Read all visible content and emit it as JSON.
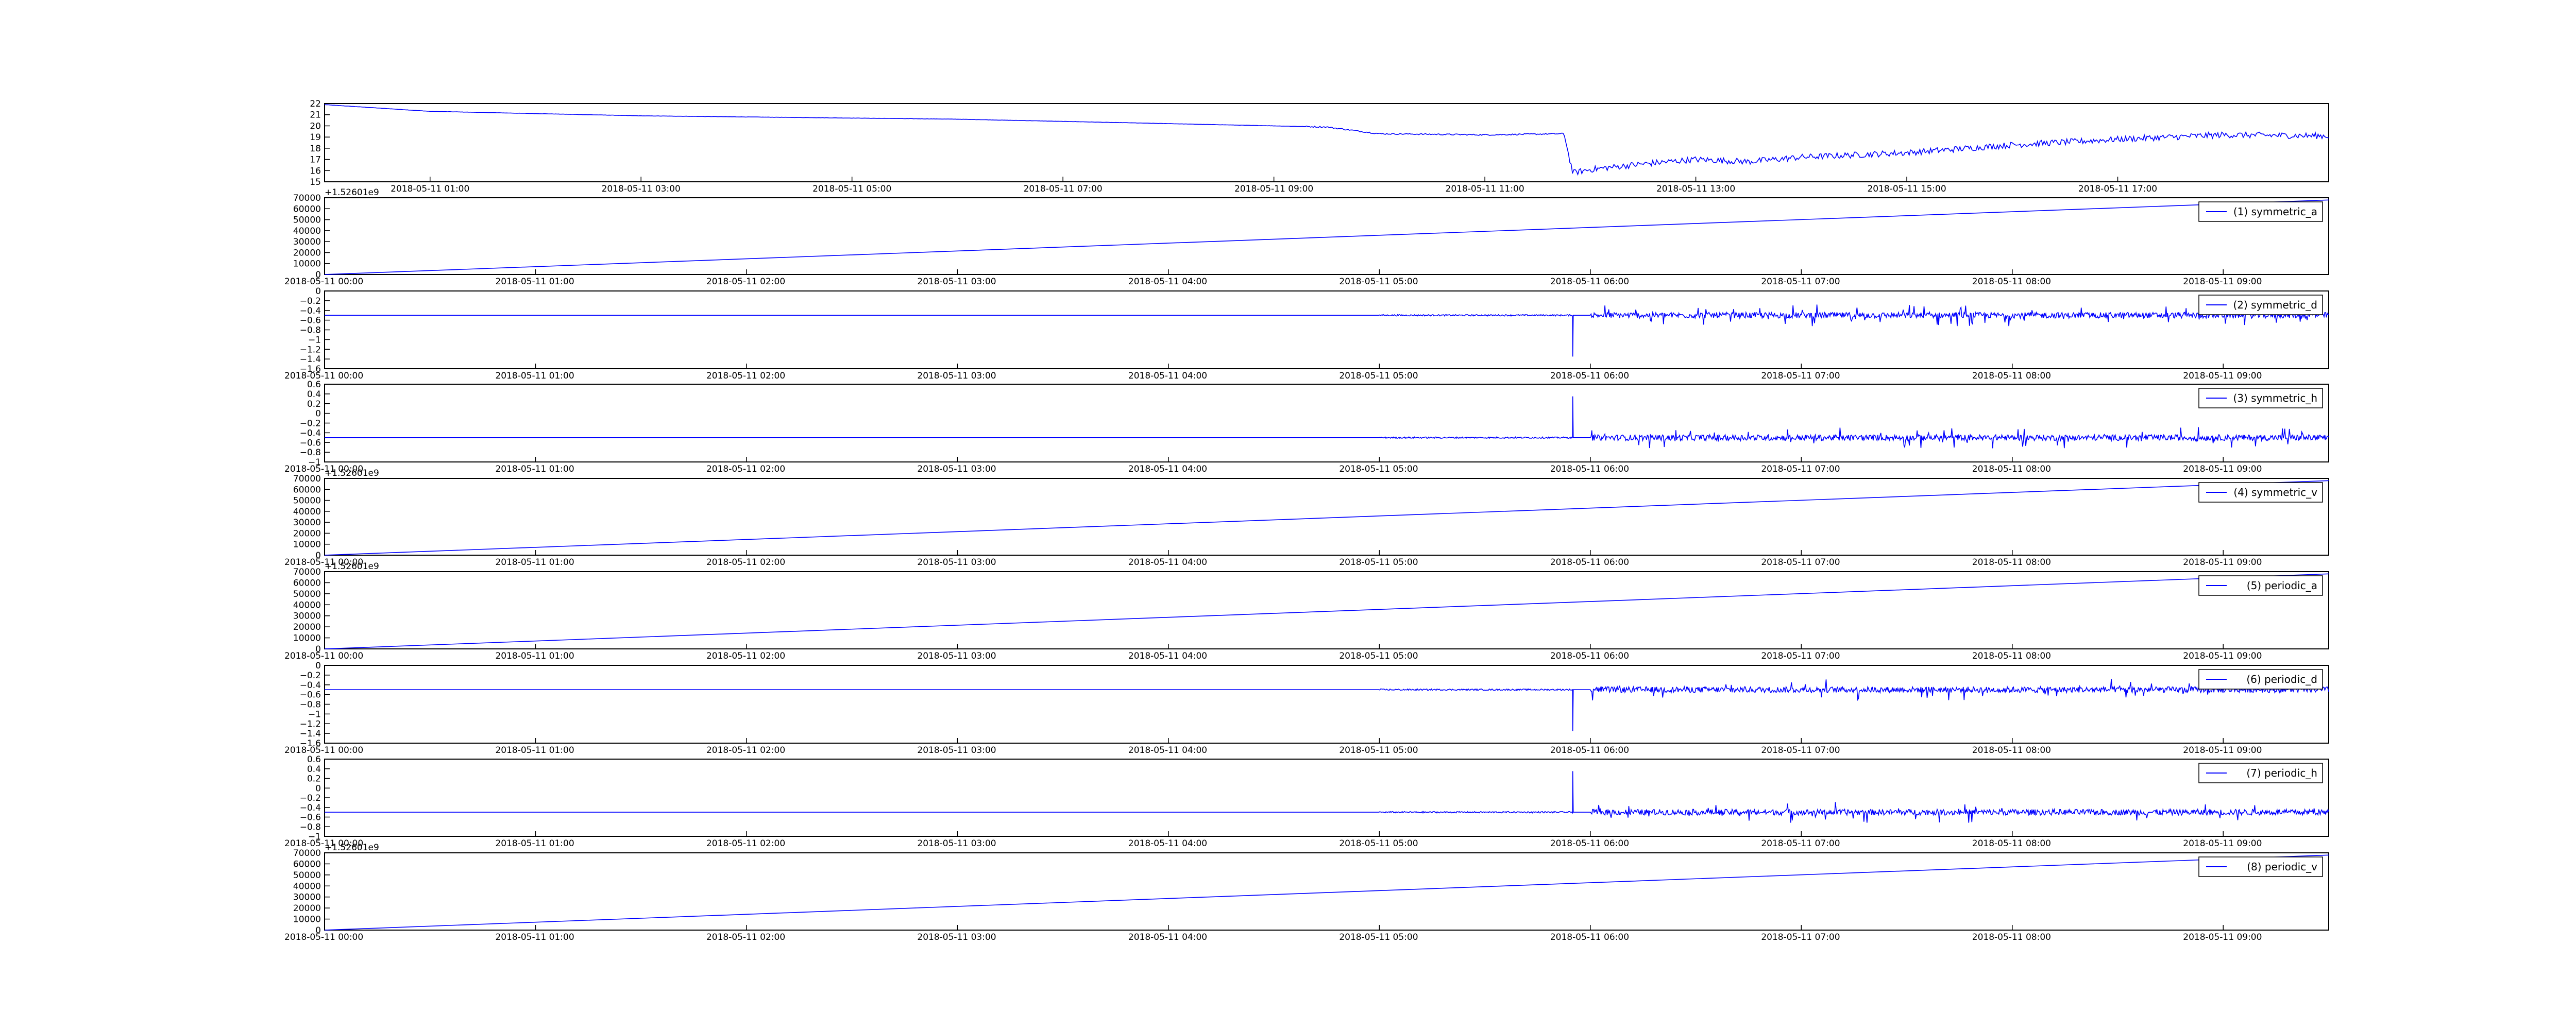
{
  "figure": {
    "line_color": "#0000ff",
    "frame_color": "#000000",
    "background": "#ffffff"
  },
  "chart_data": [
    {
      "type": "line",
      "legend": null,
      "x_label_anchor": "middle",
      "x_ticks": [
        "2018-05-11 01:00",
        "2018-05-11 03:00",
        "2018-05-11 05:00",
        "2018-05-11 07:00",
        "2018-05-11 09:00",
        "2018-05-11 11:00",
        "2018-05-11 13:00",
        "2018-05-11 15:00",
        "2018-05-11 17:00"
      ],
      "y_ticks": [
        15,
        16,
        17,
        18,
        19,
        20,
        21,
        22
      ],
      "ylim": [
        15,
        22
      ],
      "offset_label": "",
      "signal": "temperature",
      "series": [
        {
          "x": [
            "2018-05-11 00:00",
            "2018-05-11 01:00",
            "2018-05-11 02:00",
            "2018-05-11 03:00",
            "2018-05-11 04:00",
            "2018-05-11 05:00",
            "2018-05-11 06:00",
            "2018-05-11 07:00",
            "2018-05-11 08:00",
            "2018-05-11 09:00",
            "2018-05-11 09:30",
            "2018-05-11 10:00",
            "2018-05-11 11:00",
            "2018-05-11 11:45",
            "2018-05-11 11:50",
            "2018-05-11 12:00",
            "2018-05-11 12:30",
            "2018-05-11 13:00",
            "2018-05-11 13:30",
            "2018-05-11 14:00",
            "2018-05-11 15:00",
            "2018-05-11 16:00",
            "2018-05-11 17:00",
            "2018-05-11 18:00",
            "2018-05-11 19:00"
          ],
          "y": [
            21.9,
            21.3,
            21.1,
            20.9,
            20.8,
            20.7,
            20.6,
            20.4,
            20.2,
            20.0,
            19.9,
            19.3,
            19.2,
            19.3,
            15.8,
            16.1,
            16.6,
            17.0,
            16.8,
            17.2,
            17.6,
            18.3,
            18.8,
            19.2,
            19.1
          ]
        }
      ]
    },
    {
      "type": "line",
      "legend": "(1) symmetric_a",
      "x_label_anchor": "start",
      "x_ticks": [
        "2018-05-11 00:00",
        "2018-05-11 01:00",
        "2018-05-11 02:00",
        "2018-05-11 03:00",
        "2018-05-11 04:00",
        "2018-05-11 05:00",
        "2018-05-11 06:00",
        "2018-05-11 07:00",
        "2018-05-11 08:00",
        "2018-05-11 09:00"
      ],
      "y_ticks": [
        0,
        10000,
        20000,
        30000,
        40000,
        50000,
        60000,
        70000
      ],
      "ylim": [
        0,
        70000
      ],
      "offset_label": "+1.52601e9",
      "signal": "ramp",
      "series": [
        {
          "x": [
            "2018-05-11 00:00",
            "2018-05-11 09:30"
          ],
          "y": [
            0,
            68000
          ]
        }
      ]
    },
    {
      "type": "line",
      "legend": "(2) symmetric_d",
      "x_label_anchor": "start",
      "x_ticks": [
        "2018-05-11 00:00",
        "2018-05-11 01:00",
        "2018-05-11 02:00",
        "2018-05-11 03:00",
        "2018-05-11 04:00",
        "2018-05-11 05:00",
        "2018-05-11 06:00",
        "2018-05-11 07:00",
        "2018-05-11 08:00",
        "2018-05-11 09:00"
      ],
      "y_ticks": [
        -1.6,
        -1.4,
        -1.2,
        -1.0,
        -0.8,
        -0.6,
        -0.4,
        -0.2,
        0.0
      ],
      "ylim": [
        -1.6,
        0.0
      ],
      "offset_label": "",
      "signal": "noise",
      "series": [
        {
          "x": [
            "2018-05-11 00:00",
            "2018-05-11 05:00",
            "2018-05-11 05:55",
            "2018-05-11 06:00",
            "2018-05-11 09:30"
          ],
          "y": [
            -0.5,
            -0.5,
            -1.35,
            -0.5,
            -0.5
          ]
        }
      ]
    },
    {
      "type": "line",
      "legend": "(3) symmetric_h",
      "x_label_anchor": "start",
      "x_ticks": [
        "2018-05-11 00:00",
        "2018-05-11 01:00",
        "2018-05-11 02:00",
        "2018-05-11 03:00",
        "2018-05-11 04:00",
        "2018-05-11 05:00",
        "2018-05-11 06:00",
        "2018-05-11 07:00",
        "2018-05-11 08:00",
        "2018-05-11 09:00"
      ],
      "y_ticks": [
        -1.0,
        -0.8,
        -0.6,
        -0.4,
        -0.2,
        0.0,
        0.2,
        0.4,
        0.6
      ],
      "ylim": [
        -1.0,
        0.6
      ],
      "offset_label": "",
      "signal": "noise",
      "series": [
        {
          "x": [
            "2018-05-11 00:00",
            "2018-05-11 05:00",
            "2018-05-11 05:55",
            "2018-05-11 06:00",
            "2018-05-11 09:30"
          ],
          "y": [
            -0.5,
            -0.5,
            0.35,
            -0.5,
            -0.5
          ]
        }
      ]
    },
    {
      "type": "line",
      "legend": "(4) symmetric_v",
      "x_label_anchor": "start",
      "x_ticks": [
        "2018-05-11 00:00",
        "2018-05-11 01:00",
        "2018-05-11 02:00",
        "2018-05-11 03:00",
        "2018-05-11 04:00",
        "2018-05-11 05:00",
        "2018-05-11 06:00",
        "2018-05-11 07:00",
        "2018-05-11 08:00",
        "2018-05-11 09:00"
      ],
      "y_ticks": [
        0,
        10000,
        20000,
        30000,
        40000,
        50000,
        60000,
        70000
      ],
      "ylim": [
        0,
        70000
      ],
      "offset_label": "+1.52601e9",
      "signal": "ramp",
      "series": [
        {
          "x": [
            "2018-05-11 00:00",
            "2018-05-11 09:30"
          ],
          "y": [
            0,
            68000
          ]
        }
      ]
    },
    {
      "type": "line",
      "legend": "(5) periodic_a",
      "x_label_anchor": "start",
      "x_ticks": [
        "2018-05-11 00:00",
        "2018-05-11 01:00",
        "2018-05-11 02:00",
        "2018-05-11 03:00",
        "2018-05-11 04:00",
        "2018-05-11 05:00",
        "2018-05-11 06:00",
        "2018-05-11 07:00",
        "2018-05-11 08:00",
        "2018-05-11 09:00"
      ],
      "y_ticks": [
        0,
        10000,
        20000,
        30000,
        40000,
        50000,
        60000,
        70000
      ],
      "ylim": [
        0,
        70000
      ],
      "offset_label": "+1.52601e9",
      "signal": "ramp",
      "series": [
        {
          "x": [
            "2018-05-11 00:00",
            "2018-05-11 09:30"
          ],
          "y": [
            0,
            68000
          ]
        }
      ]
    },
    {
      "type": "line",
      "legend": "(6) periodic_d",
      "x_label_anchor": "start",
      "x_ticks": [
        "2018-05-11 00:00",
        "2018-05-11 01:00",
        "2018-05-11 02:00",
        "2018-05-11 03:00",
        "2018-05-11 04:00",
        "2018-05-11 05:00",
        "2018-05-11 06:00",
        "2018-05-11 07:00",
        "2018-05-11 08:00",
        "2018-05-11 09:00"
      ],
      "y_ticks": [
        -1.6,
        -1.4,
        -1.2,
        -1.0,
        -0.8,
        -0.6,
        -0.4,
        -0.2,
        0.0
      ],
      "ylim": [
        -1.6,
        0.0
      ],
      "offset_label": "",
      "signal": "noise",
      "series": [
        {
          "x": [
            "2018-05-11 00:00",
            "2018-05-11 05:00",
            "2018-05-11 05:55",
            "2018-05-11 06:00",
            "2018-05-11 09:30"
          ],
          "y": [
            -0.5,
            -0.5,
            -1.35,
            -0.5,
            -0.5
          ]
        }
      ]
    },
    {
      "type": "line",
      "legend": "(7) periodic_h",
      "x_label_anchor": "start",
      "x_ticks": [
        "2018-05-11 00:00",
        "2018-05-11 01:00",
        "2018-05-11 02:00",
        "2018-05-11 03:00",
        "2018-05-11 04:00",
        "2018-05-11 05:00",
        "2018-05-11 06:00",
        "2018-05-11 07:00",
        "2018-05-11 08:00",
        "2018-05-11 09:00"
      ],
      "y_ticks": [
        -1.0,
        -0.8,
        -0.6,
        -0.4,
        -0.2,
        0.0,
        0.2,
        0.4,
        0.6
      ],
      "ylim": [
        -1.0,
        0.6
      ],
      "offset_label": "",
      "signal": "noise",
      "series": [
        {
          "x": [
            "2018-05-11 00:00",
            "2018-05-11 05:00",
            "2018-05-11 05:55",
            "2018-05-11 06:00",
            "2018-05-11 09:30"
          ],
          "y": [
            -0.5,
            -0.5,
            0.35,
            -0.5,
            -0.5
          ]
        }
      ]
    },
    {
      "type": "line",
      "legend": "(8) periodic_v",
      "x_label_anchor": "start",
      "x_ticks": [
        "2018-05-11 00:00",
        "2018-05-11 01:00",
        "2018-05-11 02:00",
        "2018-05-11 03:00",
        "2018-05-11 04:00",
        "2018-05-11 05:00",
        "2018-05-11 06:00",
        "2018-05-11 07:00",
        "2018-05-11 08:00",
        "2018-05-11 09:00"
      ],
      "y_ticks": [
        0,
        10000,
        20000,
        30000,
        40000,
        50000,
        60000,
        70000
      ],
      "ylim": [
        0,
        70000
      ],
      "offset_label": "+1.52601e9",
      "signal": "ramp",
      "series": [
        {
          "x": [
            "2018-05-11 00:00",
            "2018-05-11 09:30"
          ],
          "y": [
            0,
            68000
          ]
        }
      ]
    }
  ]
}
